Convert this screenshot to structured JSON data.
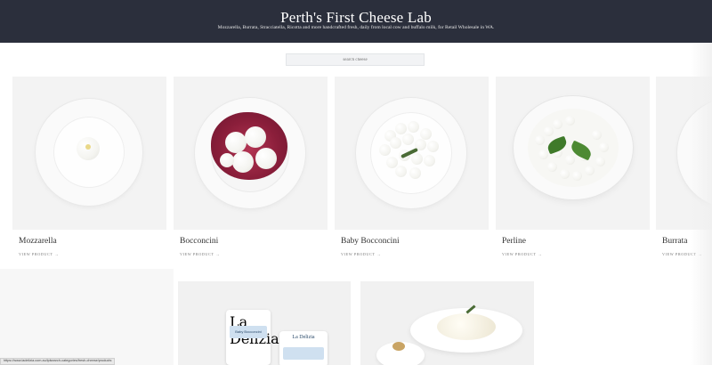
{
  "header": {
    "title": "Perth's First Cheese Lab",
    "subtitle": "Mozzarella, Burrata, Stracciatella, Ricotta and more handcrafted fresh, daily from local cow and buffalo milk, for Retail Wholesale in WA."
  },
  "search": {
    "placeholder": "search cheese"
  },
  "products": [
    {
      "name": "Mozzarella",
      "link": "VIEW PRODUCT  →"
    },
    {
      "name": "Bocconcini",
      "link": "VIEW PRODUCT  →"
    },
    {
      "name": "Baby Bocconcini",
      "link": "VIEW PRODUCT  →"
    },
    {
      "name": "Perline",
      "link": "VIEW PRODUCT  →"
    },
    {
      "name": "Burrata",
      "link": "VIEW PRODUCT  →"
    }
  ],
  "packaging": {
    "brand": "La Delizia",
    "label": "Baby Bocconcini"
  },
  "status_bar": {
    "url": "https://www.ladelizia.com.au/lplsearch-categories/fresh-cheese/products"
  },
  "colors": {
    "header_bg": "#2b2f3c",
    "radicchio": "#8a1e3a",
    "basil": "#3f7a2a"
  }
}
